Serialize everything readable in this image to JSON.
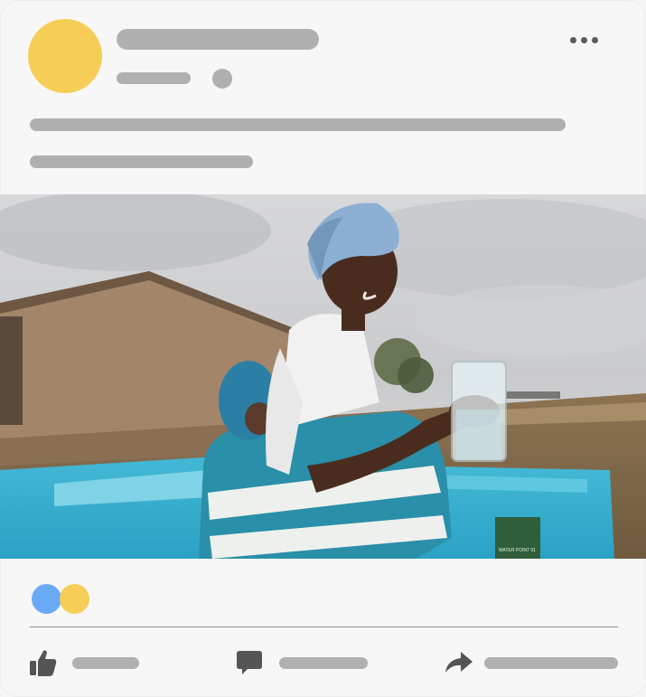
{
  "post": {
    "author_avatar": {
      "color": "#f6cd56",
      "icon": "avatar"
    },
    "placeholder_color": "#b0b0b0",
    "more_menu": {
      "icon": "more-horizontal-icon",
      "color": "#5b5b5b"
    },
    "photo": {
      "description_icon": "photo",
      "sign_text": "WATER POINT 01"
    },
    "reactions": [
      {
        "icon": "reaction-blue-icon",
        "color": "#6aaaf5"
      },
      {
        "icon": "reaction-yellow-icon",
        "color": "#f6cd56"
      }
    ],
    "actions": [
      {
        "icon": "like-icon"
      },
      {
        "icon": "comment-icon"
      },
      {
        "icon": "share-icon"
      }
    ]
  }
}
